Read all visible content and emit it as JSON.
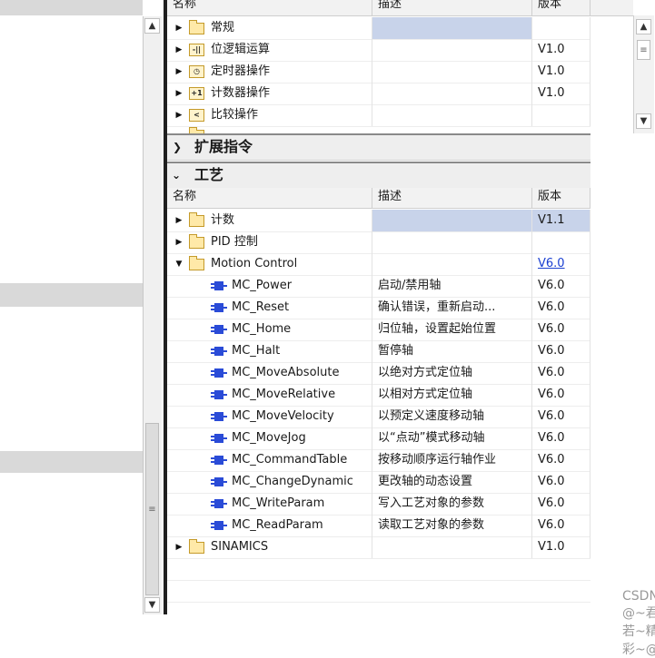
{
  "top_table": {
    "columns": [
      "名称",
      "描述",
      "版本"
    ],
    "rows": [
      {
        "name": "常规",
        "icon": "folder-icon",
        "desc": "",
        "version": ""
      },
      {
        "name": "位逻辑运算",
        "icon": "bit-logic-icon",
        "desc": "",
        "version": "V1.0"
      },
      {
        "name": "定时器操作",
        "icon": "timer-icon",
        "desc": "",
        "version": "V1.0"
      },
      {
        "name": "计数器操作",
        "icon": "counter-icon",
        "desc": "",
        "version": "V1.0"
      },
      {
        "name": "比较操作",
        "icon": "compare-icon",
        "desc": "",
        "version": ""
      }
    ]
  },
  "sections": {
    "extended": "扩展指令",
    "technology": "工艺"
  },
  "tech_table": {
    "columns": [
      "名称",
      "描述",
      "版本"
    ],
    "rows": [
      {
        "name": "计数",
        "desc": "",
        "version": "V1.1"
      },
      {
        "name": "PID 控制",
        "desc": "",
        "version": ""
      },
      {
        "name": "Motion Control",
        "desc": "",
        "version": "V6.0"
      },
      {
        "name": "MC_Power",
        "desc": "启动/禁用轴",
        "version": "V6.0"
      },
      {
        "name": "MC_Reset",
        "desc": "确认错误，重新启动...",
        "version": "V6.0"
      },
      {
        "name": "MC_Home",
        "desc": "归位轴，设置起始位置",
        "version": "V6.0"
      },
      {
        "name": "MC_Halt",
        "desc": "暂停轴",
        "version": "V6.0"
      },
      {
        "name": "MC_MoveAbsolute",
        "desc": "以绝对方式定位轴",
        "version": "V6.0"
      },
      {
        "name": "MC_MoveRelative",
        "desc": "以相对方式定位轴",
        "version": "V6.0"
      },
      {
        "name": "MC_MoveVelocity",
        "desc": "以预定义速度移动轴",
        "version": "V6.0"
      },
      {
        "name": "MC_MoveJog",
        "desc": "以“点动”模式移动轴",
        "version": "V6.0"
      },
      {
        "name": "MC_CommandTable",
        "desc": "按移动顺序运行轴作业",
        "version": "V6.0"
      },
      {
        "name": "MC_ChangeDynamic",
        "desc": "更改轴的动态设置",
        "version": "V6.0"
      },
      {
        "name": "MC_WriteParam",
        "desc": "写入工艺对象的参数",
        "version": "V6.0"
      },
      {
        "name": "MC_ReadParam",
        "desc": "读取工艺对象的参数",
        "version": "V6.0"
      },
      {
        "name": "SINAMICS",
        "desc": "",
        "version": "V1.0"
      }
    ]
  },
  "watermark": "CSDN @~君若~精彩~@"
}
